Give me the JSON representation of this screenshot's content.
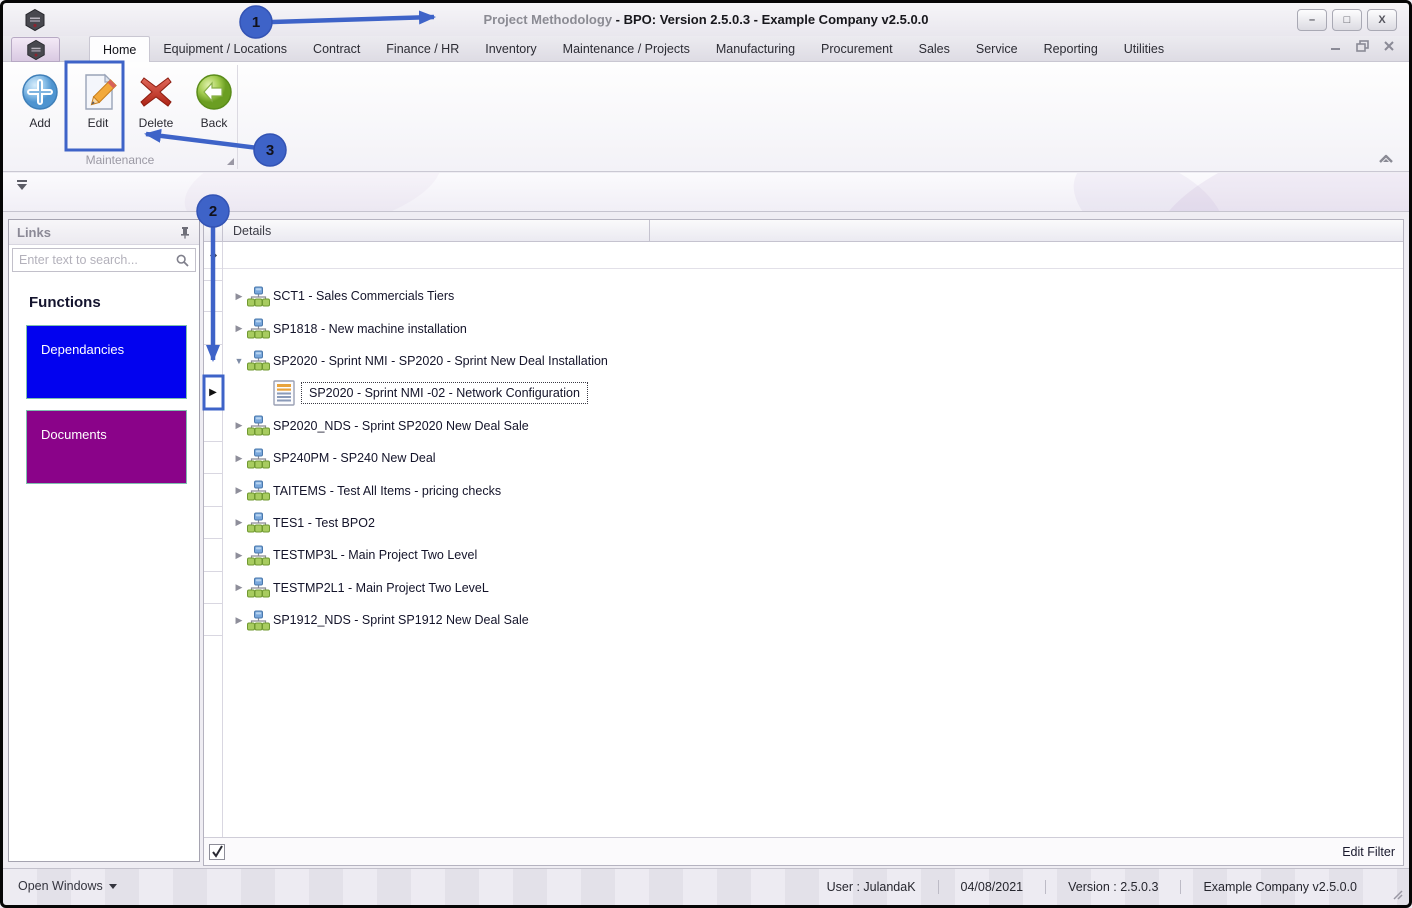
{
  "window": {
    "title_primary": "Project Methodology",
    "title_secondary": " - BPO: Version 2.5.0.3 - Example Company v2.5.0.0",
    "controls": {
      "minimize": "–",
      "maximize": "□",
      "close": "X"
    }
  },
  "tabs": {
    "selected": "Home",
    "items": [
      "Home",
      "Equipment / Locations",
      "Contract",
      "Finance / HR",
      "Inventory",
      "Maintenance / Projects",
      "Manufacturing",
      "Procurement",
      "Sales",
      "Service",
      "Reporting",
      "Utilities"
    ]
  },
  "ribbon": {
    "group_label": "Maintenance",
    "buttons": [
      {
        "label": "Add",
        "icon": "add-icon"
      },
      {
        "label": "Edit",
        "icon": "edit-icon"
      },
      {
        "label": "Delete",
        "icon": "delete-icon"
      },
      {
        "label": "Back",
        "icon": "back-icon"
      }
    ]
  },
  "links_panel": {
    "title": "Links",
    "search_placeholder": "Enter text to search...",
    "section_title": "Functions",
    "items": [
      {
        "label": "Dependancies",
        "color": "#0202ef"
      },
      {
        "label": "Documents",
        "color": "#8a0389"
      }
    ]
  },
  "grid": {
    "column_header": "Details",
    "footer_link": "Edit Filter",
    "rows": [
      {
        "label": "SCT1 - Sales Commercials Tiers",
        "icon": "project",
        "expand": "collapsed",
        "level": 0,
        "focused": false,
        "current": false
      },
      {
        "label": "SP1818 - New machine installation",
        "icon": "project",
        "expand": "collapsed",
        "level": 0,
        "focused": false,
        "current": false
      },
      {
        "label": "SP2020 - Sprint NMI - SP2020 - Sprint New Deal Installation",
        "icon": "project",
        "expand": "expanded",
        "level": 0,
        "focused": false,
        "current": false
      },
      {
        "label": "SP2020 - Sprint NMI -02 - Network Configuration",
        "icon": "task",
        "expand": "none",
        "level": 1,
        "focused": true,
        "current": true
      },
      {
        "label": "SP2020_NDS - Sprint SP2020 New Deal Sale",
        "icon": "project",
        "expand": "collapsed",
        "level": 0,
        "focused": false,
        "current": false
      },
      {
        "label": "SP240PM - SP240 New Deal",
        "icon": "project",
        "expand": "collapsed",
        "level": 0,
        "focused": false,
        "current": false
      },
      {
        "label": "TAITEMS - Test All Items - pricing checks",
        "icon": "project",
        "expand": "collapsed",
        "level": 0,
        "focused": false,
        "current": false
      },
      {
        "label": "TES1 - Test BPO2",
        "icon": "project",
        "expand": "collapsed",
        "level": 0,
        "focused": false,
        "current": false
      },
      {
        "label": "TESTMP3L - Main Project Two Level",
        "icon": "project",
        "expand": "collapsed",
        "level": 0,
        "focused": false,
        "current": false
      },
      {
        "label": "TESTMP2L1 - Main Project Two LeveL",
        "icon": "project",
        "expand": "collapsed",
        "level": 0,
        "focused": false,
        "current": false
      },
      {
        "label": "SP1912_NDS - Sprint SP1912 New Deal Sale",
        "icon": "project",
        "expand": "collapsed",
        "level": 0,
        "focused": false,
        "current": false
      }
    ]
  },
  "status_bar": {
    "open_windows": "Open Windows",
    "user": "User : JulandaK",
    "date": "04/08/2021",
    "version": "Version : 2.5.0.3",
    "company": "Example Company v2.5.0.0"
  },
  "annotations": {
    "accent": "#3e63c8",
    "c1": "1",
    "c2": "2",
    "c3": "3"
  }
}
